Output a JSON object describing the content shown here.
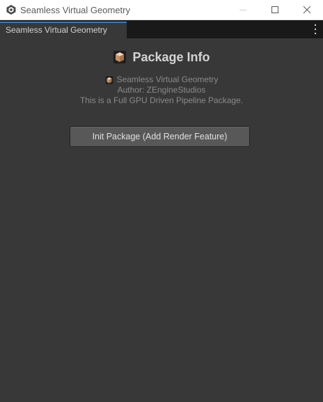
{
  "window": {
    "title": "Seamless Virtual Geometry",
    "icon": "unity-logo-icon",
    "controls": [
      "minimize-icon",
      "maximize-icon",
      "close-icon"
    ]
  },
  "tabs": [
    {
      "label": "Seamless Virtual Geometry",
      "active": true
    }
  ],
  "header": {
    "title": "Package Info",
    "icon": "package-icon"
  },
  "info": {
    "name": "Seamless Virtual Geometry",
    "author": "Author: ZEngineStudios",
    "description": "This is a Full GPU Driven Pipeline Package."
  },
  "actions": {
    "init_label": "Init Package (Add Render Feature)"
  },
  "colors": {
    "background": "#383838",
    "tabstrip": "#191919",
    "tab_accent": "#3a79bb",
    "button": "#585858"
  }
}
